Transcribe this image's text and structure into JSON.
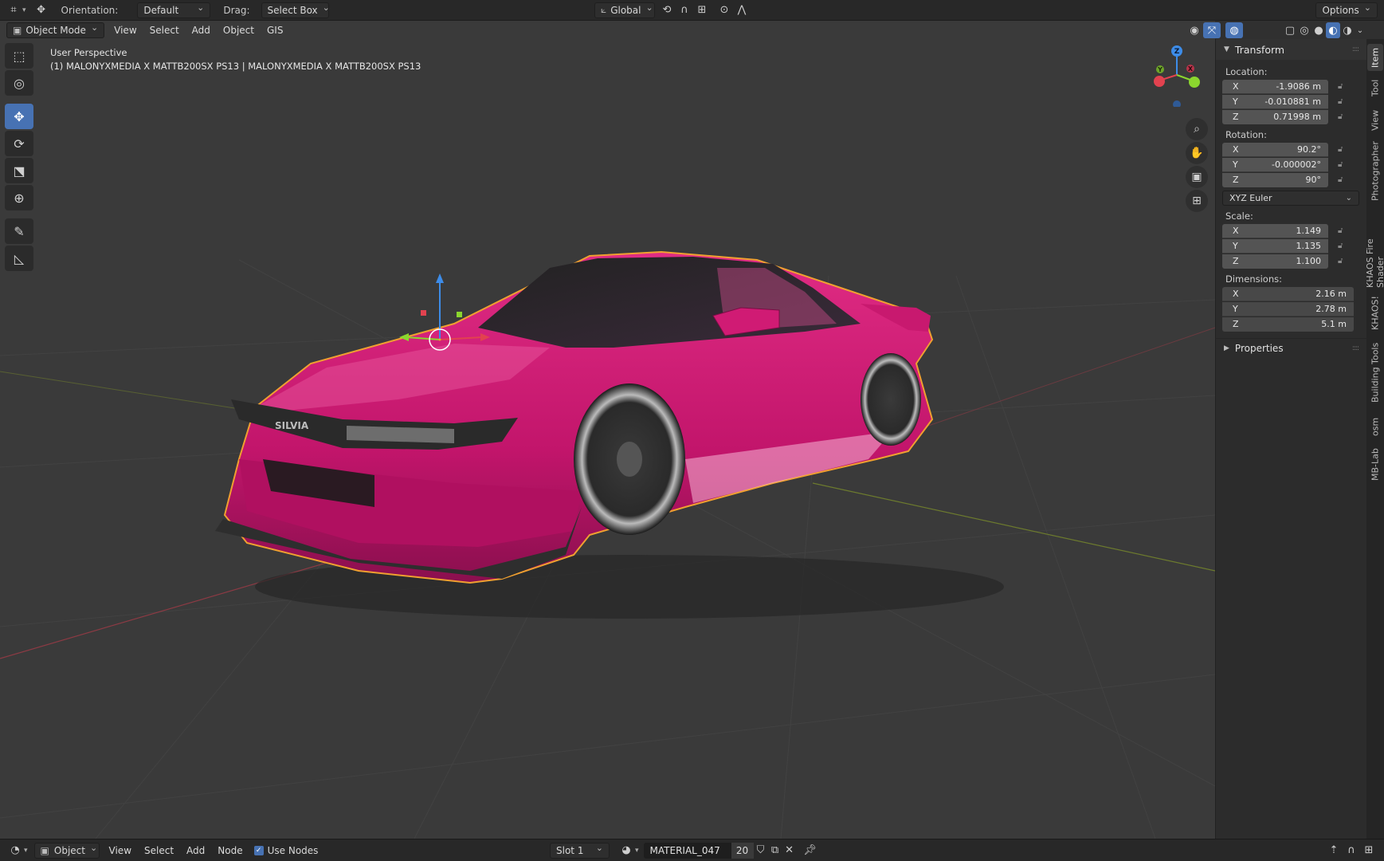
{
  "header": {
    "editor_icon": "3d-viewport-icon",
    "orientation_label": "Orientation:",
    "orientation_value": "Default",
    "drag_label": "Drag:",
    "drag_value": "Select Box",
    "transform_orientation": "Global",
    "options_label": "Options"
  },
  "viewport_header": {
    "mode": "Object Mode",
    "menus": [
      "View",
      "Select",
      "Add",
      "Object",
      "GIS"
    ]
  },
  "viewport": {
    "perspective": "User Perspective",
    "object_info": "(1) MALONYXMEDIA X MATTB200SX PS13 | MALONYXMEDIA X MATTB200SX PS13",
    "car_badge": "SILVIA",
    "gizmo_axes": [
      "X",
      "Y",
      "Z"
    ]
  },
  "tools": [
    "select-box-icon",
    "cursor-icon",
    "move-icon",
    "rotate-icon",
    "scale-icon",
    "transform-icon",
    "annotate-icon",
    "measure-icon"
  ],
  "npanel": {
    "transform_title": "Transform",
    "location_label": "Location:",
    "location": [
      {
        "axis": "X",
        "value": "-1.9086 m"
      },
      {
        "axis": "Y",
        "value": "-0.010881 m"
      },
      {
        "axis": "Z",
        "value": "0.71998 m"
      }
    ],
    "rotation_label": "Rotation:",
    "rotation": [
      {
        "axis": "X",
        "value": "90.2°"
      },
      {
        "axis": "Y",
        "value": "-0.000002°"
      },
      {
        "axis": "Z",
        "value": "90°"
      }
    ],
    "rotation_mode": "XYZ Euler",
    "scale_label": "Scale:",
    "scale": [
      {
        "axis": "X",
        "value": "1.149"
      },
      {
        "axis": "Y",
        "value": "1.135"
      },
      {
        "axis": "Z",
        "value": "1.100"
      }
    ],
    "dimensions_label": "Dimensions:",
    "dimensions": [
      {
        "axis": "X",
        "value": "2.16 m"
      },
      {
        "axis": "Y",
        "value": "2.78 m"
      },
      {
        "axis": "Z",
        "value": "5.1 m"
      }
    ],
    "properties_title": "Properties",
    "tabs": [
      "Item",
      "Tool",
      "View",
      "Photographer",
      "KHAOS Fire Shader",
      "KHAOS!",
      "Building Tools",
      "osm",
      "MB-Lab"
    ]
  },
  "bottom": {
    "editor_type": "Object",
    "menus": [
      "View",
      "Select",
      "Add",
      "Node"
    ],
    "use_nodes_label": "Use Nodes",
    "slot": "Slot 1",
    "material": "MATERIAL_047",
    "user_count": "20"
  },
  "colors": {
    "accent": "#4772b3",
    "car_body": "#d4186e",
    "selection_outline": "#f0a030",
    "axis_x": "#e2424f",
    "axis_y": "#8bd62e",
    "axis_z": "#3d8ce8"
  }
}
